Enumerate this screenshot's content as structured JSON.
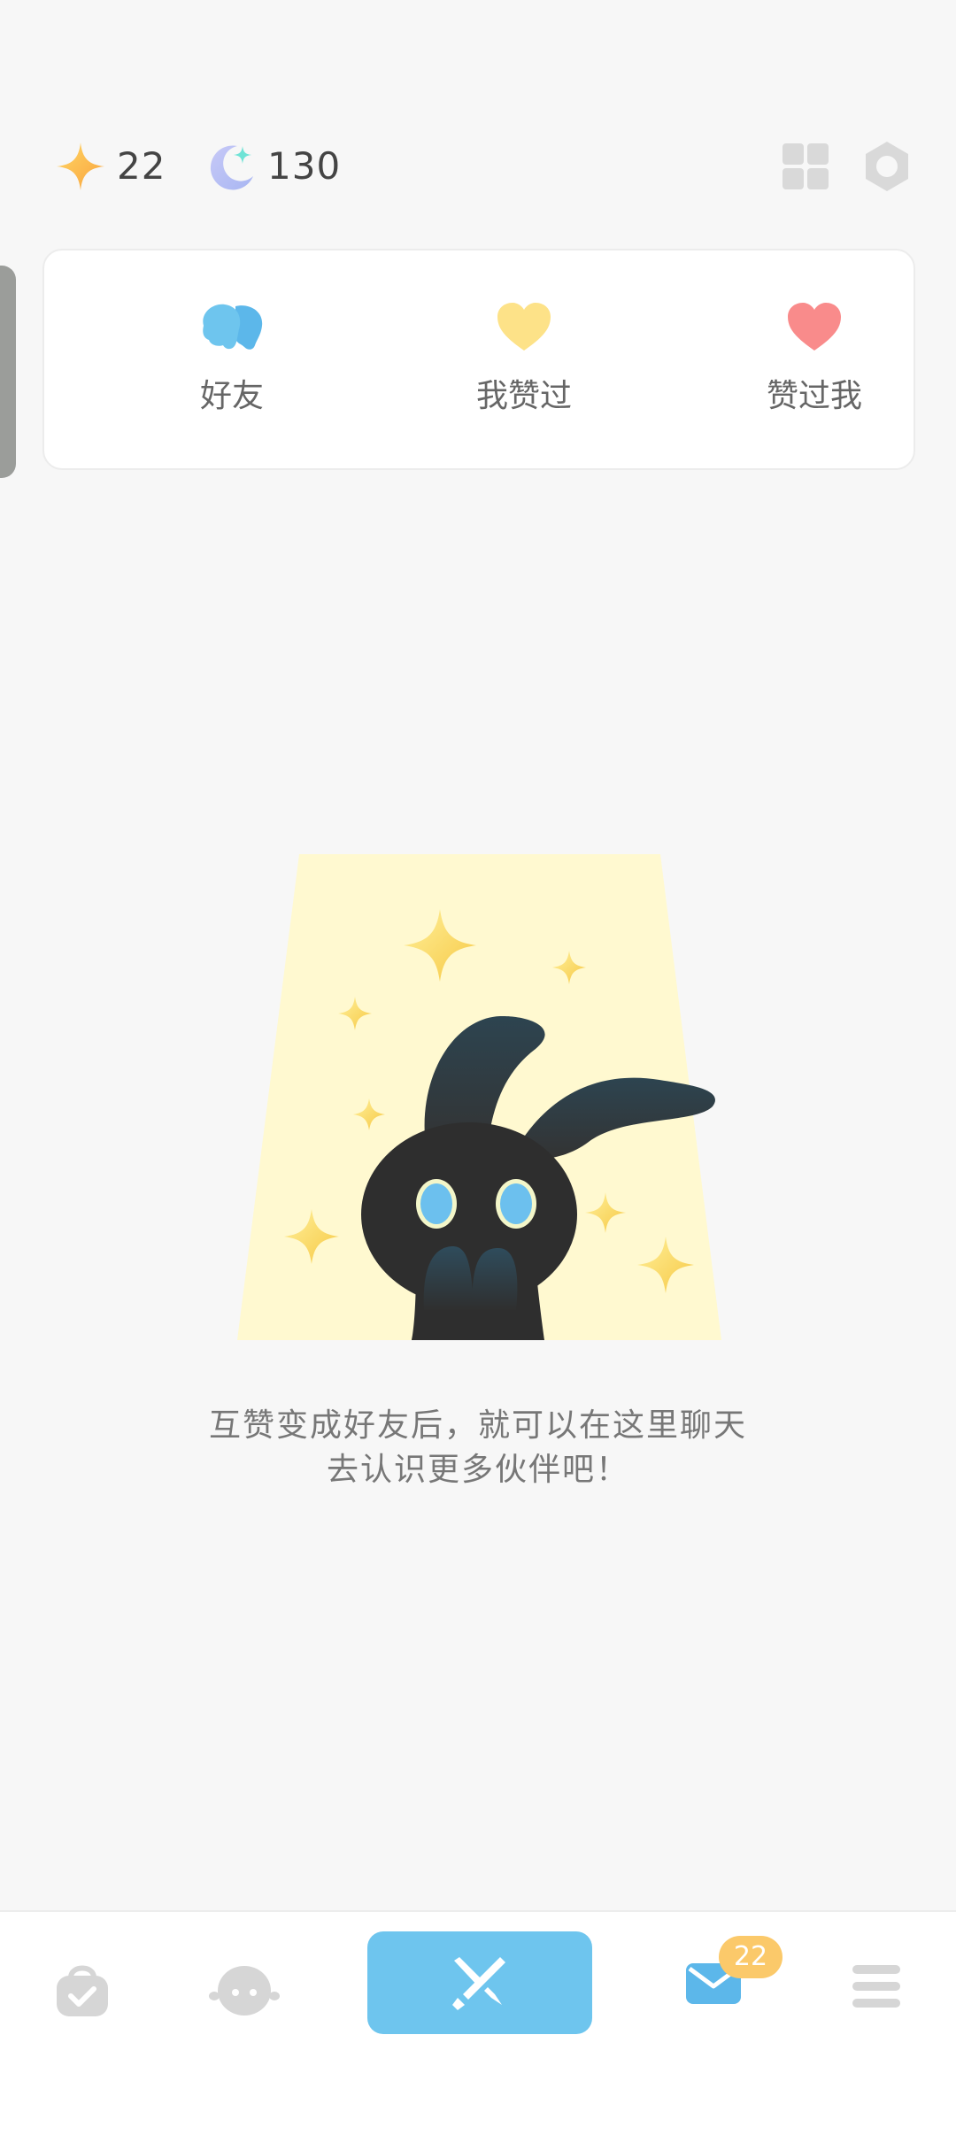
{
  "header": {
    "stars_count": "22",
    "moons_count": "130",
    "icons": [
      "star-icon",
      "moon-icon",
      "grid-icon",
      "settings-icon"
    ]
  },
  "tabs": {
    "friends_label": "好友",
    "liked_label": "我赞过",
    "likers_label": "赞过我"
  },
  "empty_state": {
    "line1": "互赞变成好友后，就可以在这里聊天",
    "line2": "去认识更多伙伴吧！"
  },
  "bottom_nav": {
    "mail_badge": "22",
    "icons": [
      "shop-bag-icon",
      "avatar-icon",
      "swords-icon",
      "mail-icon",
      "menu-icon"
    ]
  },
  "colors": {
    "background": "#f7f7f7",
    "accent_blue": "#6ec5ee",
    "badge_yellow": "#fbc96a",
    "heart_yellow": "#fde288",
    "heart_red": "#f98b8b"
  }
}
